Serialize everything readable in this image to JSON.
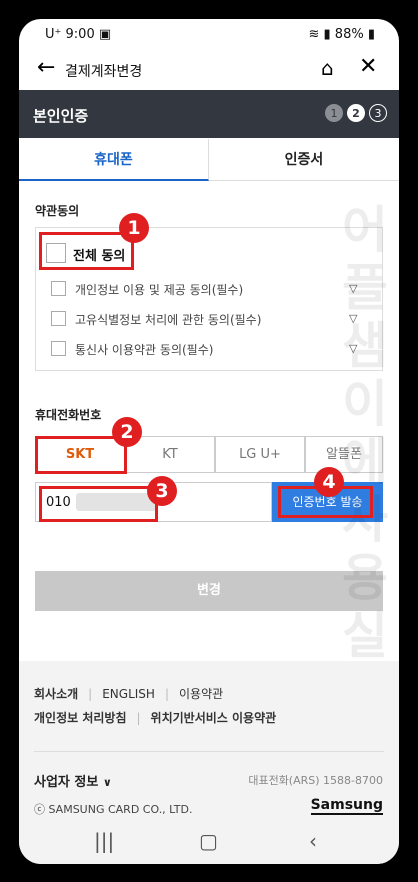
{
  "status": {
    "carrier": "U⁺",
    "time": "9:00",
    "battery": "88%"
  },
  "appbar": {
    "title": "결제계좌변경"
  },
  "header": {
    "title": "본인인증",
    "steps": [
      "1",
      "2",
      "3"
    ]
  },
  "tabs": [
    "휴대폰",
    "인증서"
  ],
  "terms": {
    "label": "약관동의",
    "all": "전체 동의",
    "items": [
      "개인정보 이용 및 제공 동의(필수)",
      "고유식별정보 처리에 관한 동의(필수)",
      "통신사 이용약관 동의(필수)"
    ]
  },
  "phone": {
    "label": "휴대전화번호",
    "carriers": [
      "SKT",
      "KT",
      "LG U+",
      "알뜰폰"
    ],
    "value": "010",
    "send_label": "인증번호 발송"
  },
  "change_label": "변경",
  "watermark": [
    "어",
    "플",
    "샘",
    "이",
    "에",
    "사",
    "용",
    "실"
  ],
  "annotations": [
    "1",
    "2",
    "3",
    "4"
  ],
  "footer": {
    "links1": [
      "회사소개",
      "ENGLISH",
      "이용약관"
    ],
    "links2": [
      "개인정보 처리방침",
      "위치기반서비스 이용약관"
    ],
    "biz": "사업자 정보",
    "tel": "대표전화(ARS) 1588-8700",
    "copy": "ⓒ SAMSUNG CARD CO., LTD.",
    "brand": "Samsung"
  },
  "colors": {
    "accent": "#1a64c8",
    "annotation": "#e02020",
    "send": "#2f7de1"
  }
}
